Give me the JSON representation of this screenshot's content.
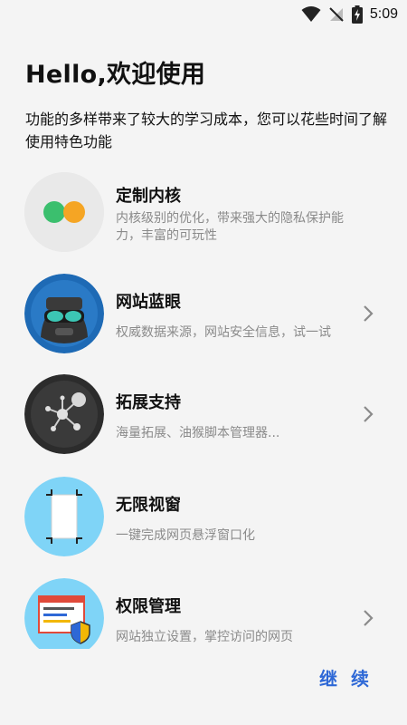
{
  "status": {
    "time": "5:09"
  },
  "title": "Hello,欢迎使用",
  "subtitle": "功能的多样带来了较大的学习成本，您可以花些时间了解使用特色功能",
  "features": [
    {
      "name": "定制内核",
      "desc": "内核级别的优化，带来强大的隐私保护能力，丰富的可玩性",
      "icon": "toggle-dots-icon",
      "has_arrow": false
    },
    {
      "name": "网站蓝眼",
      "desc": "权威数据来源，网站安全信息，试一试",
      "icon": "goggles-mask-icon",
      "has_arrow": true
    },
    {
      "name": "拓展支持",
      "desc": "海量拓展、油猴脚本管理器...",
      "icon": "molecule-network-icon",
      "has_arrow": true
    },
    {
      "name": "无限视窗",
      "desc": "一键完成网页悬浮窗口化",
      "icon": "floating-window-icon",
      "has_arrow": false
    },
    {
      "name": "权限管理",
      "desc": "网站独立设置，掌控访问的网页",
      "icon": "browser-shield-icon",
      "has_arrow": true
    }
  ],
  "continue_label": "继 续",
  "colors": {
    "accent": "#2e68d6",
    "background": "#f4f4f4"
  }
}
